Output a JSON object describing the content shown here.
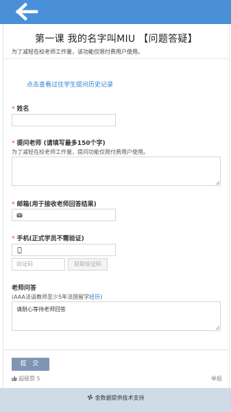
{
  "header": {
    "back_icon": "arrow-left-icon"
  },
  "page": {
    "title": "第一课 我的名字叫MIU 【问题答疑】",
    "subtitle": "为了减轻在校老师工作量，该功能仅限付费用户使用。",
    "history_link": "点击查看过往学生提问历史记录"
  },
  "form": {
    "name": {
      "required_mark": "*",
      "label": "姓名",
      "value": ""
    },
    "question": {
      "required_mark": "*",
      "label": "提问老师 (请填写最多150个字)",
      "hint": "为了减轻在校老师工作量，提问功能仅限付费用户使用。",
      "value": ""
    },
    "email": {
      "required_mark": "*",
      "label": "邮箱(用于接收老师回答结果)",
      "icon": "envelope-icon",
      "value": ""
    },
    "phone": {
      "required_mark": "*",
      "label": "手机(正式学员不需验证)",
      "icon": "mobile-phone-icon",
      "value": "",
      "code_placeholder": "验证码",
      "get_code_label": "获取验证码"
    },
    "teacher_answer": {
      "label": "老师问答",
      "hint_prefix": "(AAA法语教师至少5年法国留学",
      "hint_link": "经历",
      "hint_suffix": ")",
      "placeholder": "请耐心等待老师回答"
    }
  },
  "actions": {
    "submit_label": "提 交",
    "like_icon": "thumbs-up-icon",
    "like_label": "超级赞 5",
    "report_label": "举报"
  },
  "footer": {
    "icon": "pinwheel-icon",
    "text": "金数据提供技术支持"
  },
  "colors": {
    "topbar": "#4a90d9",
    "link": "#2f7fd1",
    "required": "#e0413a",
    "submit": "#7f95b3",
    "footer": "#cfdbe7"
  }
}
